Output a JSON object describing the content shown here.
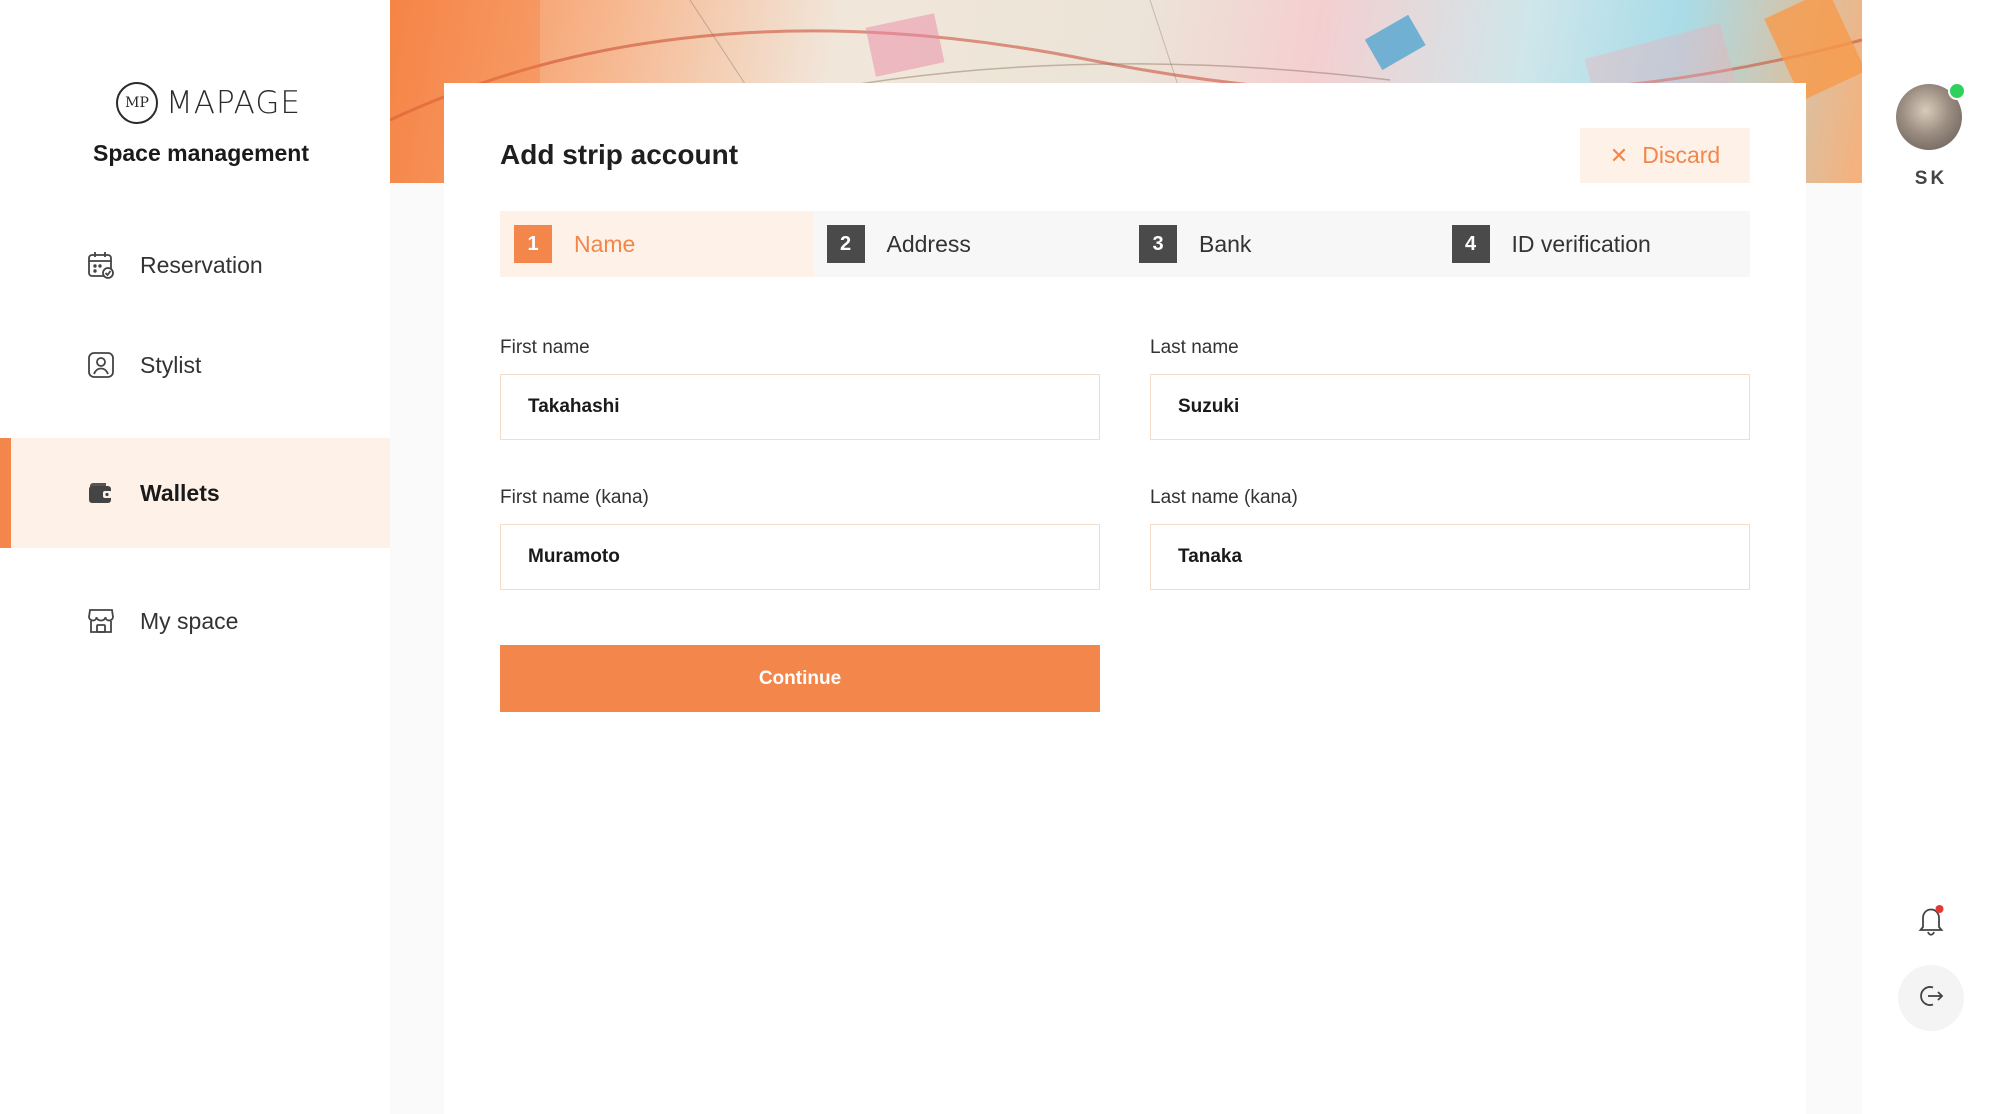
{
  "brand": {
    "logo_mark": "MP",
    "logo_text": "MAPAGE",
    "subtitle": "Space management"
  },
  "sidebar": {
    "items": [
      {
        "label": "Reservation",
        "icon": "calendar-icon",
        "active": false
      },
      {
        "label": "Stylist",
        "icon": "stylist-badge-icon",
        "active": false
      },
      {
        "label": "Wallets",
        "icon": "wallet-icon",
        "active": true
      },
      {
        "label": "My space",
        "icon": "storefront-icon",
        "active": false
      }
    ]
  },
  "form": {
    "title": "Add strip account",
    "discard_label": "Discard",
    "steps": [
      {
        "num": "1",
        "label": "Name",
        "active": true
      },
      {
        "num": "2",
        "label": "Address",
        "active": false
      },
      {
        "num": "3",
        "label": "Bank",
        "active": false
      },
      {
        "num": "4",
        "label": "ID verification",
        "active": false
      }
    ],
    "fields": {
      "first_name": {
        "label": "First name",
        "value": "Takahashi"
      },
      "last_name": {
        "label": "Last name",
        "value": "Suzuki"
      },
      "first_name_kana": {
        "label": "First name (kana)",
        "value": "Muramoto"
      },
      "last_name_kana": {
        "label": "Last name (kana)",
        "value": "Tanaka"
      }
    },
    "continue_label": "Continue"
  },
  "user": {
    "initials": "SK",
    "online": true
  },
  "colors": {
    "accent": "#f3864a",
    "accent_light": "#fdf1e8",
    "online": "#2ed15a",
    "notification": "#e53935"
  }
}
